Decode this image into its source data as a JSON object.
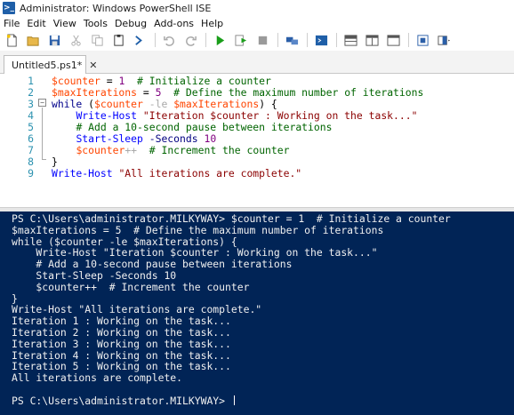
{
  "window": {
    "title": "Administrator: Windows PowerShell ISE",
    "logo_text": ">_"
  },
  "menu": [
    "File",
    "Edit",
    "View",
    "Tools",
    "Debug",
    "Add-ons",
    "Help"
  ],
  "toolbar_icons": [
    "new-file-icon",
    "open-folder-icon",
    "save-icon",
    "cut-icon",
    "copy-icon",
    "paste-icon",
    "powershell-prompt-icon",
    "undo-icon",
    "redo-icon",
    "run-icon",
    "run-selection-icon",
    "stop-icon",
    "remote-icon",
    "console-icon",
    "layout-top-icon",
    "layout-right-icon",
    "layout-max-icon",
    "command-addon-icon",
    "toggle-pane-icon"
  ],
  "tab": {
    "label": "Untitled5.ps1*",
    "close_glyph": "✕"
  },
  "editor": {
    "line_numbers": [
      "1",
      "2",
      "3",
      "4",
      "5",
      "6",
      "7",
      "8",
      "9"
    ],
    "lines": [
      [
        [
          "var",
          "$counter"
        ],
        [
          "plain",
          " = "
        ],
        [
          "num",
          "1"
        ],
        [
          "plain",
          "  "
        ],
        [
          "com",
          "# Initialize a counter"
        ]
      ],
      [
        [
          "var",
          "$maxIterations"
        ],
        [
          "plain",
          " = "
        ],
        [
          "num",
          "5"
        ],
        [
          "plain",
          "  "
        ],
        [
          "com",
          "# Define the maximum number of iterations"
        ]
      ],
      [
        [
          "kw",
          "while"
        ],
        [
          "plain",
          " ("
        ],
        [
          "var",
          "$counter"
        ],
        [
          "plain",
          " "
        ],
        [
          "op",
          "-le"
        ],
        [
          "plain",
          " "
        ],
        [
          "var",
          "$maxIterations"
        ],
        [
          "plain",
          ") {"
        ]
      ],
      [
        [
          "plain",
          "    "
        ],
        [
          "cmd",
          "Write-Host"
        ],
        [
          "plain",
          " "
        ],
        [
          "str",
          "\"Iteration $counter : Working on the task...\""
        ]
      ],
      [
        [
          "plain",
          "    "
        ],
        [
          "com",
          "# Add a 10-second pause between iterations"
        ]
      ],
      [
        [
          "plain",
          "    "
        ],
        [
          "cmd",
          "Start-Sleep"
        ],
        [
          "plain",
          " "
        ],
        [
          "param",
          "-Seconds"
        ],
        [
          "plain",
          " "
        ],
        [
          "num",
          "10"
        ]
      ],
      [
        [
          "plain",
          "    "
        ],
        [
          "var",
          "$counter"
        ],
        [
          "op",
          "++"
        ],
        [
          "plain",
          "  "
        ],
        [
          "com",
          "# Increment the counter"
        ]
      ],
      [
        [
          "plain",
          "}"
        ]
      ],
      [
        [
          "cmd",
          "Write-Host"
        ],
        [
          "plain",
          " "
        ],
        [
          "str",
          "\"All iterations are complete.\""
        ]
      ]
    ]
  },
  "console": {
    "lines": [
      "PS C:\\Users\\administrator.MILKYWAY> $counter = 1  # Initialize a counter",
      "$maxIterations = 5  # Define the maximum number of iterations",
      "while ($counter -le $maxIterations) {",
      "    Write-Host \"Iteration $counter : Working on the task...\"",
      "    # Add a 10-second pause between iterations",
      "    Start-Sleep -Seconds 10",
      "    $counter++  # Increment the counter",
      "}",
      "Write-Host \"All iterations are complete.\"",
      "Iteration 1 : Working on the task...",
      "Iteration 2 : Working on the task...",
      "Iteration 3 : Working on the task...",
      "Iteration 4 : Working on the task...",
      "Iteration 5 : Working on the task...",
      "All iterations are complete.",
      "",
      "PS C:\\Users\\administrator.MILKYWAY> "
    ]
  },
  "colors": {
    "console_bg": "#012456",
    "variable": "#ff4500",
    "comment": "#006400",
    "keyword": "#00008b",
    "command": "#0000ff",
    "string": "#8b0000",
    "number": "#800080",
    "line_number": "#2b91af"
  }
}
